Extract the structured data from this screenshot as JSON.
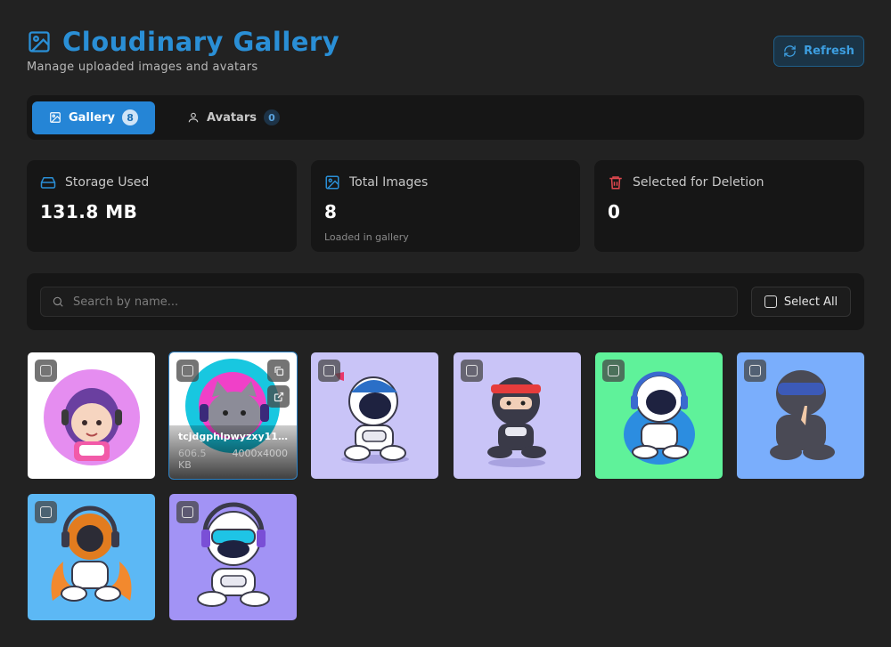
{
  "header": {
    "title": "Cloudinary Gallery",
    "subtitle": "Manage uploaded images and avatars",
    "refresh_label": "Refresh"
  },
  "tabs": [
    {
      "label": "Gallery",
      "count": "8",
      "active": true
    },
    {
      "label": "Avatars",
      "count": "0",
      "active": false
    }
  ],
  "stats": {
    "storage": {
      "label": "Storage Used",
      "value": "131.8 MB"
    },
    "total": {
      "label": "Total Images",
      "value": "8",
      "sub": "Loaded in gallery"
    },
    "deletion": {
      "label": "Selected for Deletion",
      "value": "0"
    }
  },
  "search": {
    "placeholder": "Search by name...",
    "select_all_label": "Select All"
  },
  "gallery": {
    "items": [
      {
        "background": "#ffffff"
      },
      {
        "background": "#ffffff",
        "name": "tcjdgphlpwyzxy11...",
        "size": "606.5 KB",
        "dimensions": "4000x4000"
      },
      {
        "background": "#c9c4f7"
      },
      {
        "background": "#c9c4f7"
      },
      {
        "background": "#5ff29a"
      },
      {
        "background": "#7aaefc"
      },
      {
        "background": "#5cb8f5"
      },
      {
        "background": "#a293f5"
      }
    ]
  },
  "colors": {
    "accent": "#2a8fd6",
    "tab_active": "#2585d6",
    "danger": "#e0484f"
  }
}
